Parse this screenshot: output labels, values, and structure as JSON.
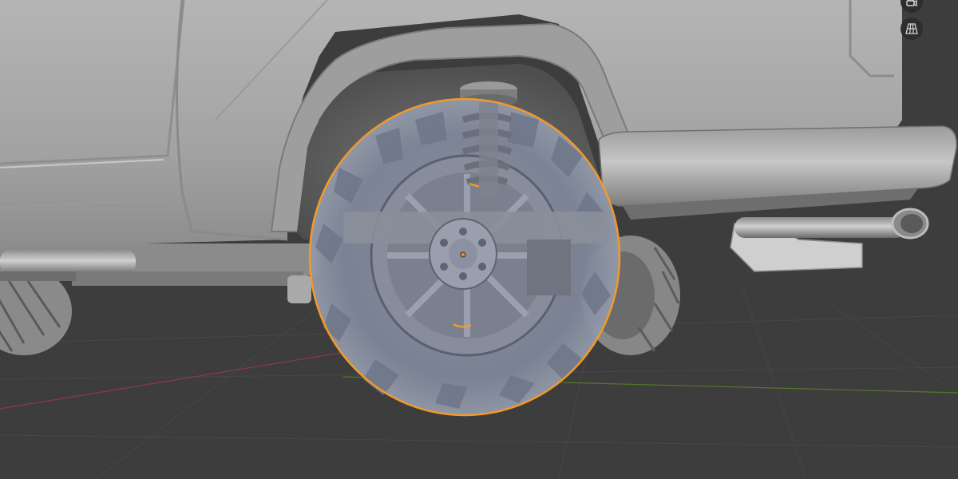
{
  "viewport": {
    "mode": "Object Mode",
    "background_color": "#3d3d3d",
    "grid_color": "#4a4a4a",
    "x_axis_color": "#9b3a4a",
    "y_axis_color": "#5a7a2a",
    "selection_outline_color": "#f19a2a",
    "origin_color": "#f08a1c"
  },
  "scene": {
    "vehicle": {
      "body_color": "#a8a8a8",
      "selected_object": "front-wheel"
    }
  },
  "navigation_gizmo": {
    "buttons": [
      {
        "icon": "camera-view-icon"
      },
      {
        "icon": "orthographic-grid-icon"
      }
    ]
  }
}
